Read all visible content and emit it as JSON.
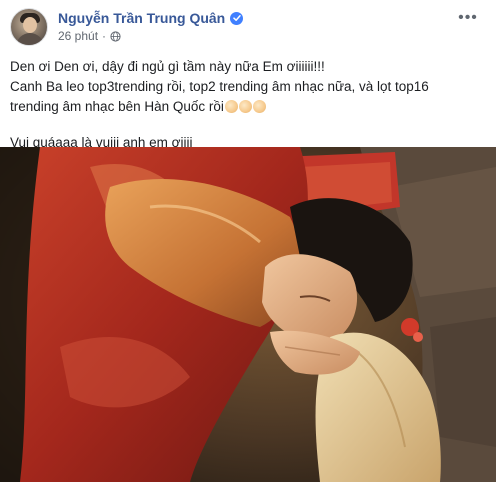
{
  "post": {
    "author": "Nguyễn Trần Trung Quân",
    "timestamp": "26 phút",
    "separator": "·",
    "more_label": "•••",
    "lines": [
      "Den ơi Den ơi, dậy đi ngủ gì tầm này nữa Em ơiiiiii!!!",
      "Canh Ba leo top3trending rồi, top2 trending âm nhạc nữa, và lọt top16",
      "trending âm nhạc bên Hàn Quốc rồi"
    ],
    "closing_line": "Vui quáaaa là vuiii anh em ơiiii",
    "emoji": [
      "clapping-hands",
      "clapping-hands",
      "clapping-hands"
    ],
    "icons": {
      "verified": "verified-badge-icon",
      "privacy": "globe-icon",
      "more": "more-options-icon"
    },
    "colors": {
      "author": "#385898",
      "verified": "#4080ff",
      "text": "#1c1e21",
      "meta": "#616770"
    }
  }
}
